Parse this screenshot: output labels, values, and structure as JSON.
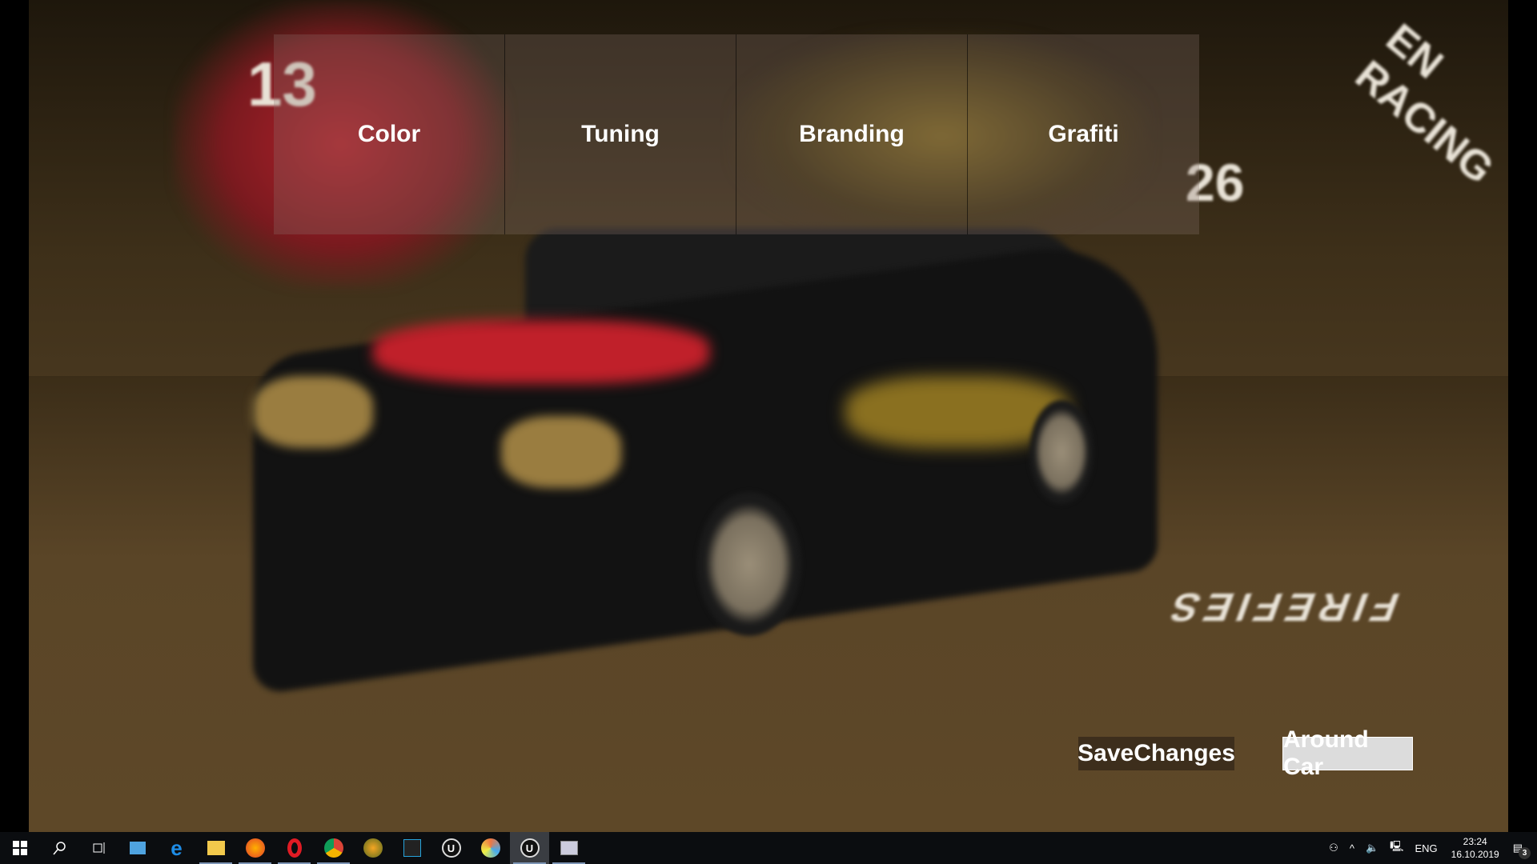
{
  "scene": {
    "wall_numbers": [
      "13",
      "26"
    ],
    "wall_texts": [
      "EN RACING",
      "FIREFIES"
    ]
  },
  "menu": {
    "tabs": [
      {
        "label": "Color"
      },
      {
        "label": "Tuning"
      },
      {
        "label": "Branding"
      },
      {
        "label": "Grafiti"
      }
    ]
  },
  "actions": {
    "save_label": "SaveChanges",
    "around_label": "Around Car"
  },
  "taskbar": {
    "apps": [
      "start-icon",
      "search-icon",
      "task-view-icon",
      "remote-desktop-icon",
      "edge-icon",
      "file-explorer-icon",
      "firefox-icon",
      "opera-icon",
      "chrome-icon",
      "fl-studio-icon",
      "movie-maker-icon",
      "unreal-engine-icon",
      "paint-icon",
      "unreal-engine-active-icon",
      "task-manager-icon"
    ],
    "tray": {
      "language": "ENG",
      "time": "23:24",
      "date": "16.10.2019",
      "notifications": "3"
    }
  },
  "colors": {
    "accent_red": "#c0202a",
    "taskbar": "#0b0d10",
    "tile": "rgba(140,120,110,0.28)"
  }
}
